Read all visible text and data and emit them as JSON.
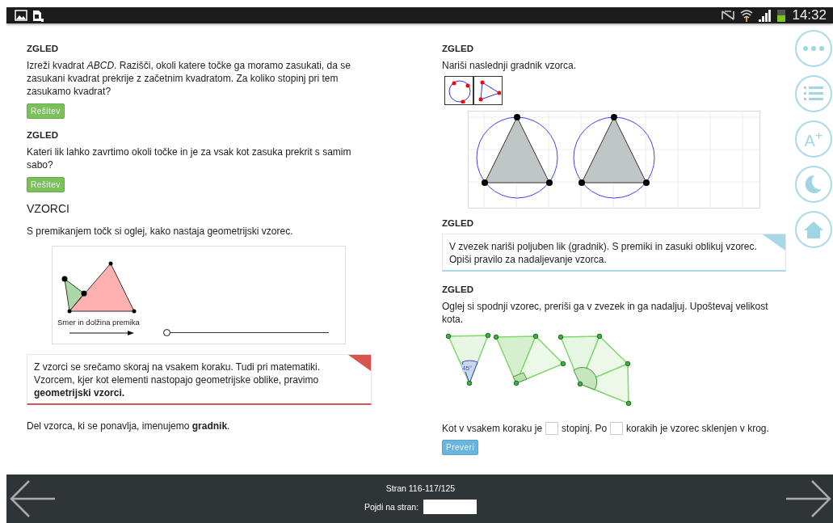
{
  "status_bar": {
    "time": "14:32"
  },
  "left_column": [
    {
      "kind": "example",
      "heading": "ZGLED",
      "text": "Izreži kvadrat *ABCD*. Razišči, okoli katere točke ga moramo zasukati, da se zasukani kvadrat prekrije z začetnim kvadratom. Za koliko stopinj pri tem zasukamo kvadrat?",
      "button": "Rešitev"
    },
    {
      "kind": "example",
      "heading": "ZGLED",
      "text": "Kateri lik lahko zavrtimo okoli točke in je za vsak kot zasuka prekrit s samim sabo?",
      "button": "Rešitev"
    },
    {
      "kind": "title",
      "text": "VZORCI"
    },
    {
      "kind": "paragraph",
      "text": "S premikanjem točk si oglej, kako nastaja geometrijski vzorec."
    },
    {
      "kind": "applet",
      "slider_label": "Smer in dolžina premika",
      "level": 0
    },
    {
      "kind": "note",
      "color": "#d9534f",
      "text": "Z vzorci se srečamo skoraj na vsakem koraku. Tudi pri matematiki. Vzorcem, kjer kot elementi nastopajo geometrijske oblike, pravimo **geometrijski vzorci.**"
    },
    {
      "kind": "paragraph",
      "text": "Del vzorca, ki se ponavlja, imenujemo **gradnik**."
    }
  ],
  "right_column": [
    {
      "kind": "drawing_example",
      "heading": "ZGLED",
      "text": "Nariši naslednji gradnik vzorca."
    },
    {
      "kind": "heading",
      "text": "ZGLED"
    },
    {
      "kind": "note",
      "color": "#a8d8e8",
      "text": "V zvezek nariši poljuben lik (gradnik). S premiki in zasuki oblikuj vzorec. Opiši pravilo za nadaljevanje vzorca."
    },
    {
      "kind": "exercise",
      "heading": "ZGLED",
      "text": "Oglej si spodnji vzorec, preriši ga v zvezek in ga nadaljuj. Upoštevaj velikost kota.",
      "angle_label": "45°",
      "sentence": [
        "Kot v vsakem koraku je",
        "stopinj. Po",
        "korakih je vzorec sklenjen v krog."
      ],
      "button": "Preveri"
    }
  ],
  "side_buttons": [
    {
      "kind": "more"
    },
    {
      "kind": "list"
    },
    {
      "kind": "text-size",
      "label": "A$^{+}$"
    },
    {
      "kind": "night"
    },
    {
      "kind": "home"
    }
  ],
  "footer": {
    "page": "Stran 116-117/125",
    "goto_label": "Pojdi na stran:"
  }
}
